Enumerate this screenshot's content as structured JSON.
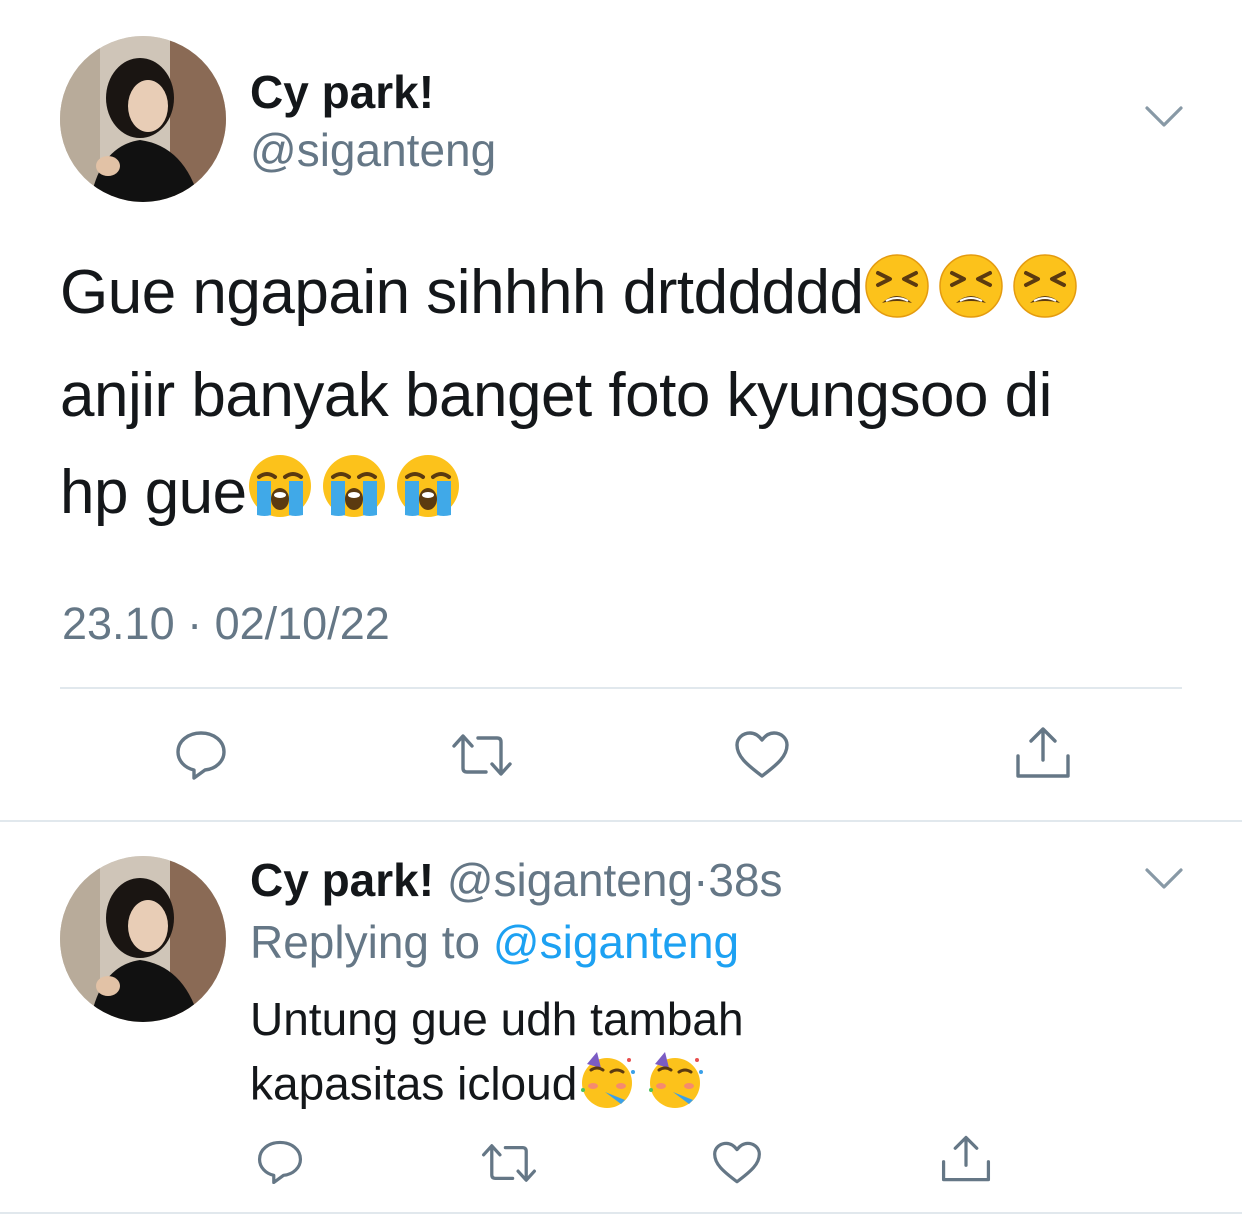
{
  "main_tweet": {
    "author_name": "Cy park!",
    "author_handle": "@siganteng",
    "text_line1": "Gue ngapain sihhhh drtddddd",
    "text_line1_emojis": [
      "tired-face-emoji",
      "tired-face-emoji",
      "tired-face-emoji"
    ],
    "text_line2": "anjir banyak banget foto kyungsoo di",
    "text_line3": "hp gue",
    "text_line3_emojis": [
      "loudly-crying-face-emoji",
      "loudly-crying-face-emoji",
      "loudly-crying-face-emoji"
    ],
    "timestamp": "23.10 · 02/10/22",
    "actions": [
      "reply-icon",
      "retweet-icon",
      "like-icon",
      "share-icon"
    ]
  },
  "reply_tweet": {
    "author_name": "Cy park!",
    "author_handle": "@siganteng",
    "separator": "·",
    "time_ago": "38s",
    "replying_prefix": "Replying to",
    "replying_handle": "@siganteng",
    "text_line1": "Untung gue udh tambah",
    "text_line2": "kapasitas icloud",
    "text_line2_emojis": [
      "partying-face-emoji",
      "partying-face-emoji"
    ],
    "actions": [
      "reply-icon",
      "retweet-icon",
      "like-icon",
      "share-icon"
    ]
  },
  "colors": {
    "text_primary": "#14171a",
    "text_secondary": "#657786",
    "link": "#1da1f2",
    "divider": "#e1e8ed"
  }
}
